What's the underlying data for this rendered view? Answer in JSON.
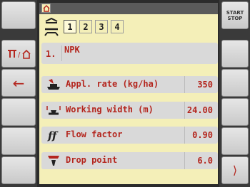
{
  "header": {
    "home_icon": "home-icon"
  },
  "tabs": [
    "1",
    "2",
    "3",
    "4"
  ],
  "product": {
    "index": "1.",
    "name": "NPK"
  },
  "rows": [
    {
      "label": "Appl. rate (kg/ha)",
      "value": "350",
      "icon": "spreader-icon"
    },
    {
      "label": "Working width (m)",
      "value": "24.00",
      "icon": "width-icon"
    },
    {
      "label": "Flow factor",
      "value": "0.90",
      "icon": "ff-icon"
    },
    {
      "label": "Drop point",
      "value": "6.0",
      "icon": "drop-point-icon"
    }
  ],
  "softkeys": {
    "start_stop": [
      "START",
      "STOP"
    ],
    "next": "⟩",
    "back": "←"
  },
  "colors": {
    "accent": "#b4261e",
    "screen": "#f4efb8",
    "frame": "#3a3a3a"
  }
}
